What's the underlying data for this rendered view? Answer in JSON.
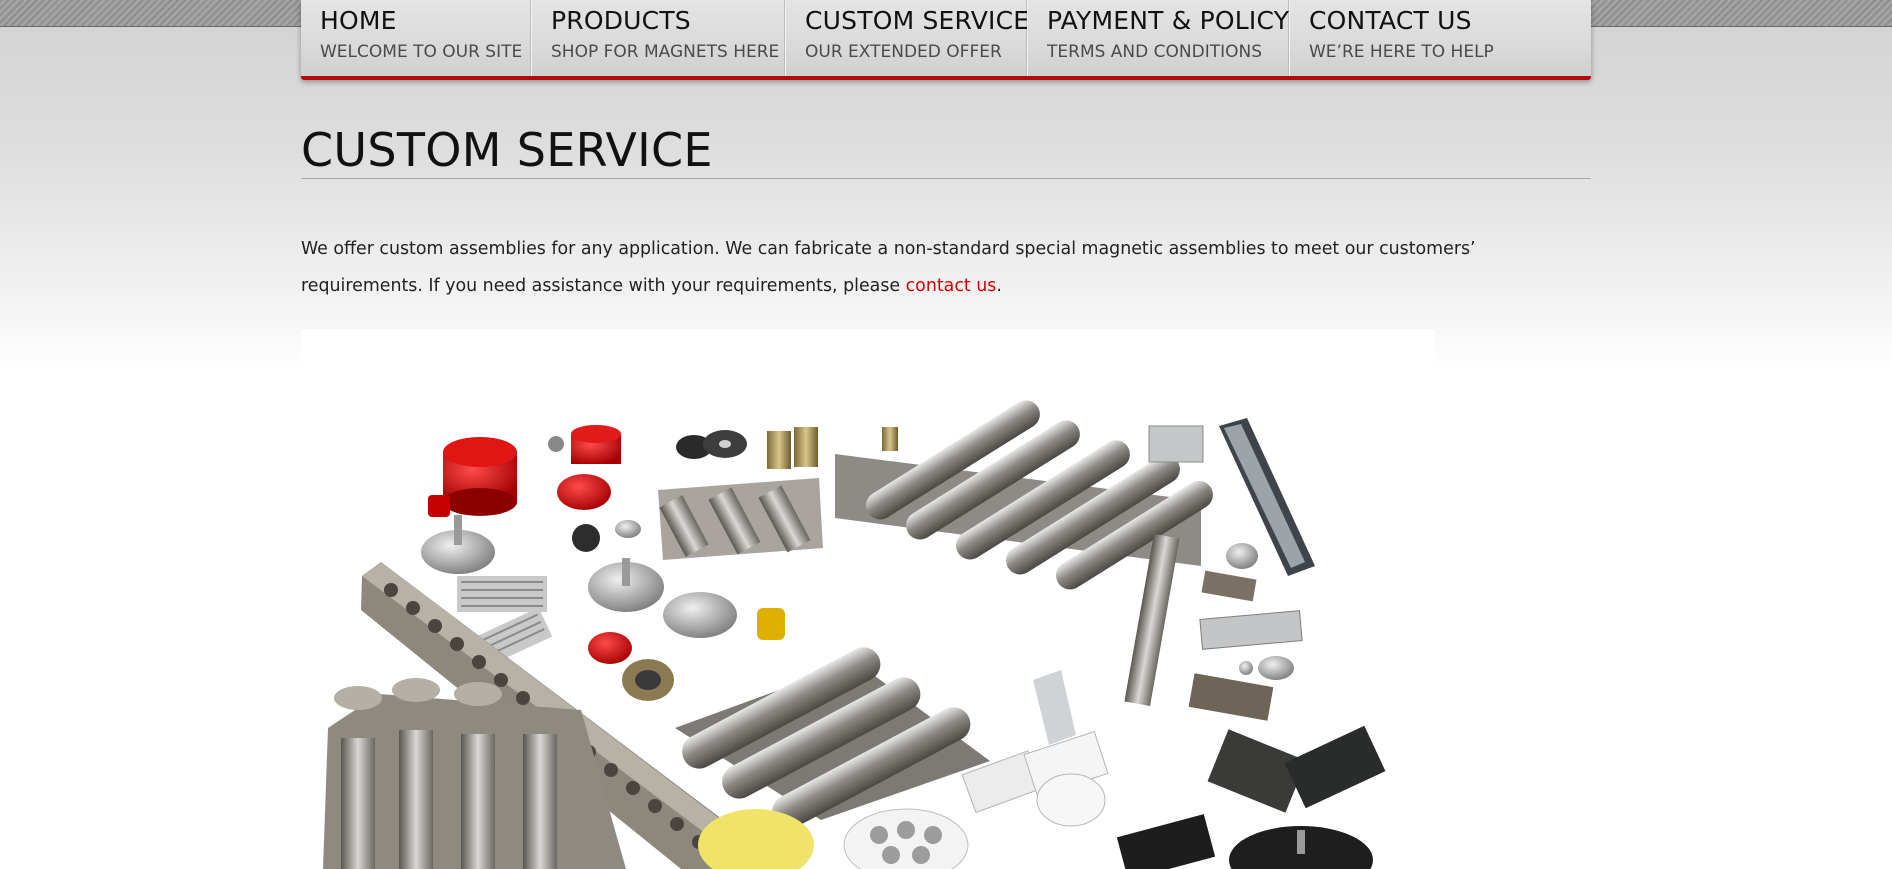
{
  "nav": {
    "items": [
      {
        "title": "HOME",
        "subtitle": "WELCOME TO OUR SITE"
      },
      {
        "title": "PRODUCTS",
        "subtitle": "SHOP FOR MAGNETS HERE"
      },
      {
        "title": "CUSTOM SERVICE",
        "subtitle": "OUR EXTENDED OFFER"
      },
      {
        "title": "PAYMENT & POLICY",
        "subtitle": "TERMS AND CONDITIONS"
      },
      {
        "title": "CONTACT US",
        "subtitle": "WE’RE HERE TO HELP"
      }
    ]
  },
  "page": {
    "title": "CUSTOM SERVICE",
    "intro_text": "We offer custom assemblies for any application. We can fabricate a non-standard special magnetic assemblies to meet our customers’ requirements. If you need assistance with your requirements, please ",
    "intro_link": "contact us",
    "intro_end": "."
  },
  "colors": {
    "accent": "#b40b0b",
    "link": "#d40000"
  },
  "image": {
    "subject": "magnetic-assemblies-product-photo"
  }
}
